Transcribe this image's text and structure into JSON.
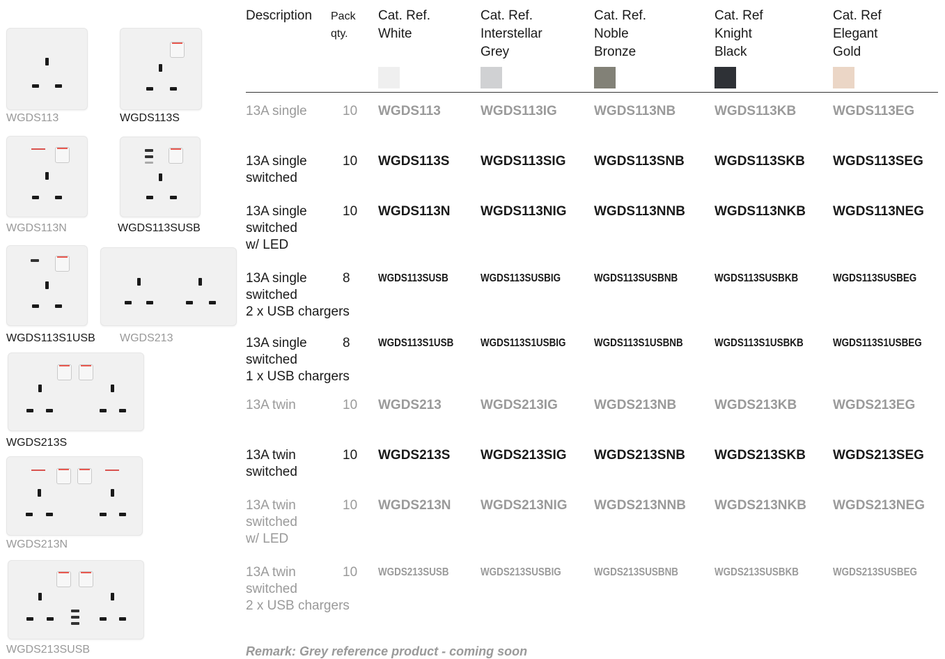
{
  "products": [
    {
      "code": "WGDS113",
      "tone": "grey"
    },
    {
      "code": "WGDS113S",
      "tone": "dark"
    },
    {
      "code": "WGDS113N",
      "tone": "grey"
    },
    {
      "code": "WGDS113SUSB",
      "tone": "dark"
    },
    {
      "code": "WGDS113S1USB",
      "tone": "dark"
    },
    {
      "code": "WGDS213",
      "tone": "grey"
    },
    {
      "code": "WGDS213S",
      "tone": "dark"
    },
    {
      "code": "WGDS213N",
      "tone": "grey"
    },
    {
      "code": "WGDS213SUSB",
      "tone": "grey"
    }
  ],
  "table": {
    "headers": {
      "description": "Description",
      "pack": "Pack\nqty.",
      "white": "Cat. Ref.\nWhite",
      "grey": "Cat. Ref.\nInterstellar\nGrey",
      "bronze": "Cat. Ref.\nNoble\nBronze",
      "black": "Cat. Ref\nKnight\nBlack",
      "gold": "Cat. Ref\nElegant\nGold"
    },
    "swatch_colors": {
      "white": "#efefef",
      "grey": "#d0d1d3",
      "bronze": "#828177",
      "black": "#2e3136",
      "gold": "#ebd6c6"
    },
    "rows": [
      {
        "desc": "13A single",
        "qty": "10",
        "tone": "grey",
        "codes": [
          "WGDS113",
          "WGDS113IG",
          "WGDS113NB",
          "WGDS113KB",
          "WGDS113EG"
        ]
      },
      {
        "desc": "13A single\nswitched",
        "qty": "10",
        "tone": "dark",
        "codes": [
          "WGDS113S",
          "WGDS113SIG",
          "WGDS113SNB",
          "WGDS113SKB",
          "WGDS113SEG"
        ]
      },
      {
        "desc": "13A single\nswitched\nw/ LED",
        "qty": "10",
        "tone": "dark",
        "codes": [
          "WGDS113N",
          "WGDS113NIG",
          "WGDS113NNB",
          "WGDS113NKB",
          "WGDS113NEG"
        ]
      },
      {
        "desc": "13A single\nswitched\n2 x USB chargers",
        "qty": "8",
        "tone": "dark",
        "codes": [
          "WGDS113SUSB",
          "WGDS113SUSBIG",
          "WGDS113SUSBNB",
          "WGDS113SUSBKB",
          "WGDS113SUSBEG"
        ]
      },
      {
        "desc": "13A single\nswitched\n1 x USB chargers",
        "qty": "8",
        "tone": "dark",
        "codes": [
          "WGDS113S1USB",
          "WGDS113S1USBIG",
          "WGDS113S1USBNB",
          "WGDS113S1USBKB",
          "WGDS113S1USBEG"
        ]
      },
      {
        "desc": "13A twin",
        "qty": "10",
        "tone": "grey",
        "codes": [
          "WGDS213",
          "WGDS213IG",
          "WGDS213NB",
          "WGDS213KB",
          "WGDS213EG"
        ]
      },
      {
        "desc": "13A twin\nswitched",
        "qty": "10",
        "tone": "dark",
        "codes": [
          "WGDS213S",
          "WGDS213SIG",
          "WGDS213SNB",
          "WGDS213SKB",
          "WGDS213SEG"
        ]
      },
      {
        "desc": "13A twin\nswitched\nw/ LED",
        "qty": "10",
        "tone": "grey",
        "codes": [
          "WGDS213N",
          "WGDS213NIG",
          "WGDS213NNB",
          "WGDS213NKB",
          "WGDS213NEG"
        ]
      },
      {
        "desc": "13A twin\nswitched\n2 x USB chargers",
        "qty": "10",
        "tone": "grey",
        "codes": [
          "WGDS213SUSB",
          "WGDS213SUSBIG",
          "WGDS213SUSBNB",
          "WGDS213SUSBKB",
          "WGDS213SUSBEG"
        ]
      }
    ]
  },
  "remark": "Remark: Grey reference product - coming soon"
}
